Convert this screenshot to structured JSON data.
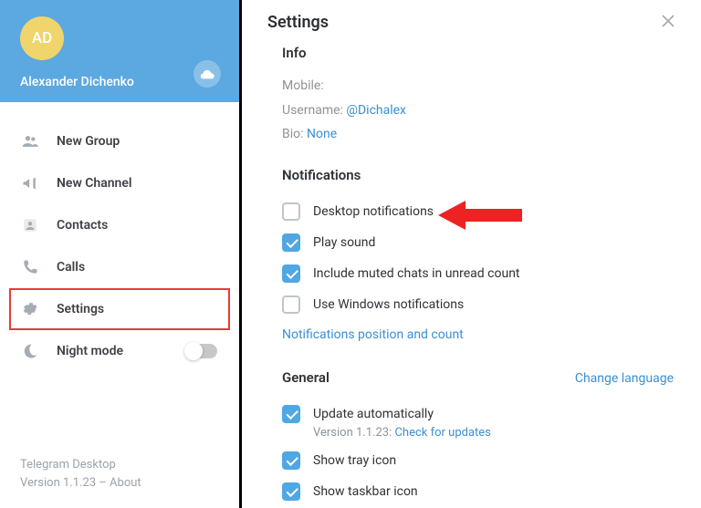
{
  "sidebar": {
    "avatar_initials": "AD",
    "username": "Alexander Dichenko",
    "menu": [
      {
        "label": "New Group",
        "icon": "group"
      },
      {
        "label": "New Channel",
        "icon": "bullhorn"
      },
      {
        "label": "Contacts",
        "icon": "person"
      },
      {
        "label": "Calls",
        "icon": "phone"
      },
      {
        "label": "Settings",
        "icon": "gear"
      },
      {
        "label": "Night mode",
        "icon": "moon"
      }
    ],
    "footer_title": "Telegram Desktop",
    "footer_version": "Version 1.1.23 – ",
    "footer_about": "About"
  },
  "settings": {
    "title": "Settings",
    "info": {
      "heading": "Info",
      "mobile_label": "Mobile:",
      "username_label": "Username:",
      "username_value": "@Dichalex",
      "bio_label": "Bio:",
      "bio_value": "None"
    },
    "notifications": {
      "heading": "Notifications",
      "items": [
        {
          "label": "Desktop notifications",
          "checked": false
        },
        {
          "label": "Play sound",
          "checked": true
        },
        {
          "label": "Include muted chats in unread count",
          "checked": true
        },
        {
          "label": "Use Windows notifications",
          "checked": false
        }
      ],
      "position_link": "Notifications position and count"
    },
    "general": {
      "heading": "General",
      "change_language": "Change language",
      "items": [
        {
          "label": "Update automatically",
          "checked": true,
          "sub": "Version 1.1.23:",
          "sub_link": "Check for updates"
        },
        {
          "label": "Show tray icon",
          "checked": true
        },
        {
          "label": "Show taskbar icon",
          "checked": true
        }
      ]
    }
  }
}
